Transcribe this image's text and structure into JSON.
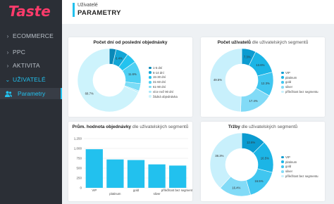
{
  "app": {
    "logo_text": "Taste"
  },
  "sidebar": {
    "items": [
      {
        "label": "ECOMMERCE",
        "chevron": "›"
      },
      {
        "label": "PPC",
        "chevron": "›"
      },
      {
        "label": "AKTIVITA",
        "chevron": "›"
      },
      {
        "label": "UŽIVATELÉ",
        "chevron": "⌄"
      }
    ],
    "active_sub": {
      "label": "Parametry",
      "icon": "users-icon"
    }
  },
  "header": {
    "breadcrumb": "Uživatelé",
    "title": "PARAMETRY"
  },
  "colors": {
    "accent": "#22c1ee"
  },
  "cards": {
    "days": {
      "title_bold": "Počet dní od poslední objednávky",
      "title_rest": ""
    },
    "users": {
      "title_bold": "Počet uživatelů",
      "title_rest": " dle uživatelských segmentů"
    },
    "avg": {
      "title_bold": "Prům. hodnota objednávky",
      "title_rest": " dle uživatelských segmentů"
    },
    "revenue": {
      "title_bold": "Tržby",
      "title_rest": " dle uživatelských segmentů"
    }
  },
  "chart_data": [
    {
      "type": "pie",
      "id": "days",
      "categories": [
        "1-5 dní",
        "6-14 dní",
        "15-30 dní",
        "31-60 dní",
        "61-90 dní",
        "více než 90 dní",
        "žádná objednávka"
      ],
      "values": [
        3.5,
        6.4,
        5.2,
        11.6,
        3.8,
        0.7,
        68.7
      ],
      "labels": [
        "",
        "6.4%",
        "",
        "11.6%",
        "",
        "",
        "68.7%"
      ],
      "colors": [
        "#0a89b8",
        "#12a6d6",
        "#23c3ef",
        "#4fd0f3",
        "#7bdcf6",
        "#a6e8f9",
        "#cdf3fc"
      ]
    },
    {
      "type": "pie",
      "id": "users",
      "categories": [
        "VIP",
        "platinum",
        "gold",
        "silver",
        "příležitost bez segmentu"
      ],
      "values": [
        7.3,
        13.6,
        12.3,
        17.4,
        49.5
      ],
      "labels": [
        "7.3%",
        "13.6%",
        "12.3%",
        "17.4%",
        "49.5%"
      ],
      "colors": [
        "#0b9bd0",
        "#1cb5e6",
        "#40c6f0",
        "#82dbf7",
        "#c8f0fc"
      ]
    },
    {
      "type": "bar",
      "id": "avg",
      "categories": [
        "VIP",
        "platinum",
        "gold",
        "silver",
        "příležitost bez segmentu"
      ],
      "values": [
        980,
        720,
        705,
        595,
        565
      ],
      "ylim": [
        0,
        1250
      ],
      "yticks": [
        "0",
        "250",
        "500",
        "750",
        "1,000",
        "1,250"
      ],
      "color": "#22c1ee"
    },
    {
      "type": "pie",
      "id": "revenue",
      "categories": [
        "VIP",
        "platinum",
        "gold",
        "silver",
        "příležitost bez segmentu"
      ],
      "values": [
        12.6,
        16.5,
        16.5,
        16.4,
        38.3
      ],
      "labels": [
        "12.6%",
        "16.5%",
        "16.5%",
        "16.4%",
        "38.3%"
      ],
      "colors": [
        "#0b9bd0",
        "#1cb5e6",
        "#40c6f0",
        "#82dbf7",
        "#c8f0fc"
      ]
    }
  ]
}
